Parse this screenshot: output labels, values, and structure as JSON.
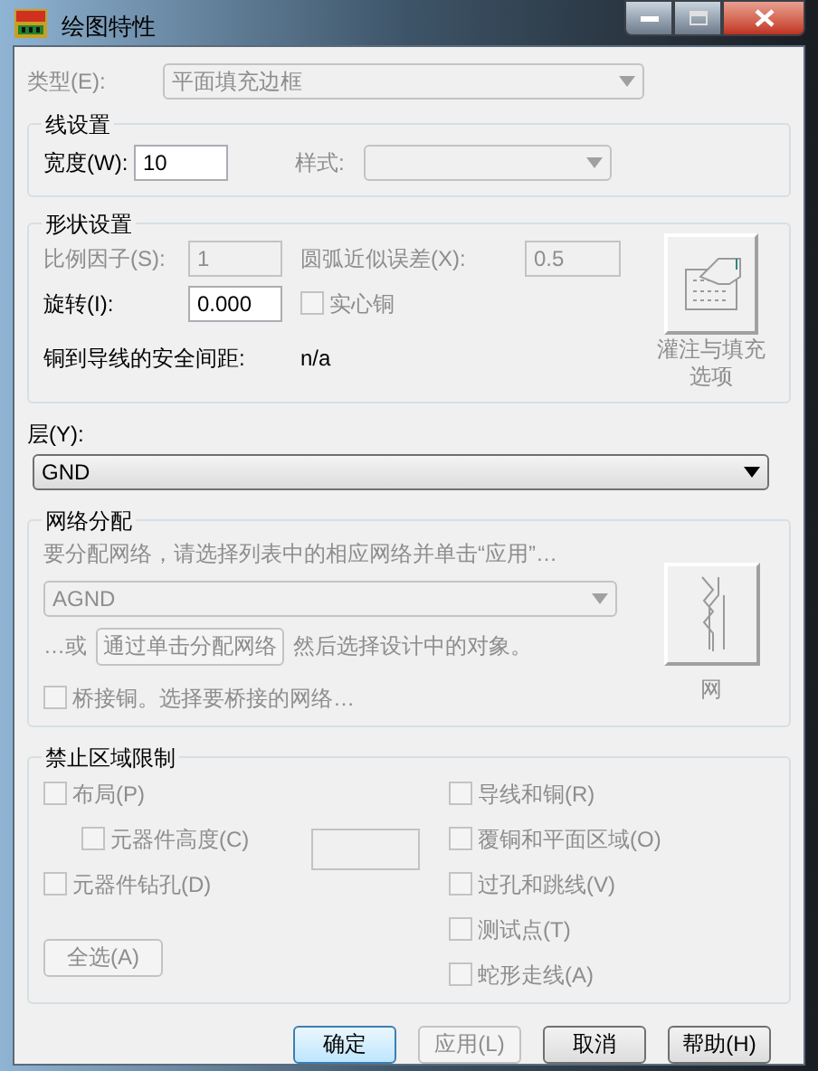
{
  "window": {
    "title": "绘图特性"
  },
  "type_field": {
    "label": "类型(E):",
    "value": "平面填充边框",
    "disabled": true
  },
  "line_settings": {
    "title": "线设置",
    "width": {
      "label": "宽度(W):",
      "value": "10",
      "disabled": false
    },
    "style": {
      "label": "样式:",
      "disabled": true
    }
  },
  "shape_settings": {
    "title": "形状设置",
    "scale": {
      "label": "比例因子(S):",
      "value": "1",
      "disabled": true
    },
    "arc_error": {
      "label": "圆弧近似误差(X):",
      "value": "0.5",
      "disabled": true
    },
    "rotation": {
      "label": "旋转(I):",
      "value": "0.000",
      "disabled": false
    },
    "solid_copper": {
      "label": "实心铜",
      "checked": false,
      "disabled": true
    },
    "clearance": {
      "label": "铜到导线的安全间距:",
      "value": "n/a"
    },
    "flood_button": {
      "label": "灌注与填充选项",
      "disabled": true
    }
  },
  "layer": {
    "label": "层(Y):",
    "value": "GND",
    "disabled": false
  },
  "net_assignment": {
    "title": "网络分配",
    "hint": "要分配网络，请选择列表中的相应网络并单击“应用”…",
    "net_select": {
      "value": "AGND",
      "disabled": true
    },
    "or_text": "…或",
    "assign_button": {
      "label": "通过单击分配网络",
      "disabled": true
    },
    "then_text": "然后选择设计中的对象。",
    "bridge": {
      "label": "桥接铜。选择要桥接的网络…",
      "checked": false,
      "disabled": true
    },
    "net_button": {
      "label": "网",
      "disabled": true
    }
  },
  "keepout": {
    "title": "禁止区域限制",
    "left": [
      {
        "label": "布局(P)",
        "checked": false,
        "disabled": true,
        "children": [
          {
            "label": "元器件高度(C)",
            "checked": false,
            "disabled": true
          }
        ]
      },
      {
        "label": "元器件钻孔(D)",
        "checked": false,
        "disabled": true
      }
    ],
    "height_field": {
      "disabled": true
    },
    "right": [
      {
        "label": "导线和铜(R)",
        "checked": false,
        "disabled": true
      },
      {
        "label": "覆铜和平面区域(O)",
        "checked": false,
        "disabled": true
      },
      {
        "label": "过孔和跳线(V)",
        "checked": false,
        "disabled": true
      },
      {
        "label": "测试点(T)",
        "checked": false,
        "disabled": true
      },
      {
        "label": "蛇形走线(A)",
        "checked": false,
        "disabled": true
      }
    ],
    "select_all": {
      "label": "全选(A)",
      "disabled": true
    }
  },
  "buttons": [
    {
      "label": "确定",
      "kind": "default",
      "disabled": false
    },
    {
      "label": "应用(L)",
      "kind": "normal",
      "disabled": true
    },
    {
      "label": "取消",
      "kind": "normal",
      "disabled": false
    },
    {
      "label": "帮助(H)",
      "kind": "normal",
      "disabled": false
    }
  ]
}
